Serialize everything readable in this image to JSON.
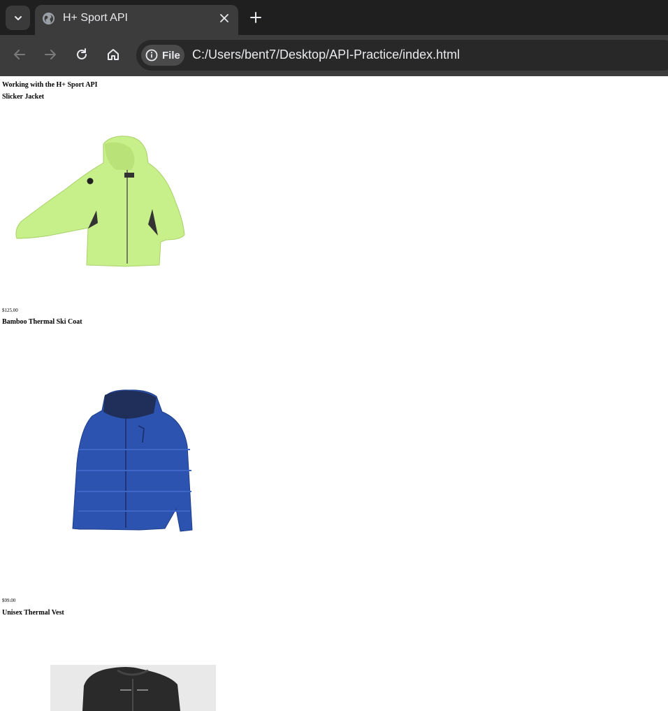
{
  "browser": {
    "tab": {
      "title": "H+ Sport API"
    },
    "toolbar": {
      "site_chip_label": "File",
      "url": "C:/Users/bent7/Desktop/API-Practice/index.html"
    },
    "icons": [
      "tab-search-icon",
      "globe-icon",
      "close-icon",
      "plus-icon",
      "back-arrow-icon",
      "forward-arrow-icon",
      "reload-icon",
      "home-icon",
      "info-icon"
    ]
  },
  "page": {
    "heading": "Working with the H+ Sport API",
    "products": [
      {
        "name": "Slicker Jacket",
        "price": "$125.00",
        "color": "#c8f08a"
      },
      {
        "name": "Bamboo Thermal Ski Coat",
        "price": "$99.00",
        "color": "#2d53b0"
      },
      {
        "name": "Unisex Thermal Vest",
        "color": "#2a2a2a"
      }
    ]
  }
}
